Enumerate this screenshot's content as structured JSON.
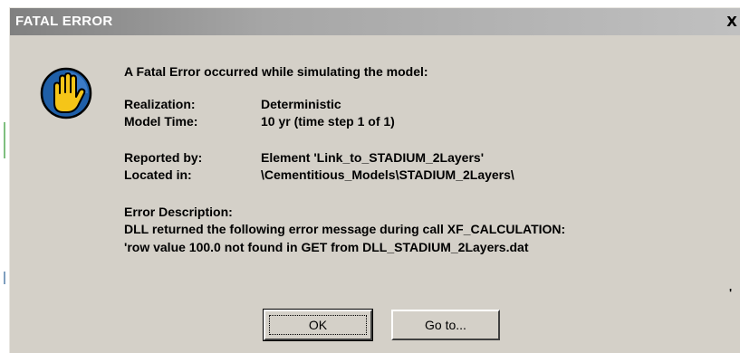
{
  "window": {
    "title": "FATAL ERROR",
    "close_label": "X"
  },
  "icon": {
    "name": "stop-hand-icon",
    "colors": {
      "hand": "#f5c518",
      "disc": "#1f5fa8",
      "outline": "#000000"
    }
  },
  "message": {
    "headline": "A Fatal Error occurred while simulating the model:",
    "realization_label": "Realization:",
    "realization_value": "Deterministic",
    "model_time_label": "Model Time:",
    "model_time_value": "10 yr  (time step 1 of 1)",
    "reported_by_label": "Reported by:",
    "reported_by_value": "Element 'Link_to_STADIUM_2Layers'",
    "located_in_label": "Located in:",
    "located_in_value": "\\Cementitious_Models\\STADIUM_2Layers\\",
    "error_description_label": "Error Description:",
    "error_line_1": "DLL returned the following error message during call XF_CALCULATION:",
    "error_line_2": "'row value 100.0 not found in GET from DLL_STADIUM_2Layers.dat",
    "stray_quote": "'"
  },
  "buttons": {
    "ok_label": "OK",
    "goto_label": "Go to..."
  },
  "colors": {
    "dialog_bg": "#d4d0c8",
    "titlebar_start": "#808080",
    "titlebar_end": "#c0c0c0",
    "title_text": "#ffffff"
  }
}
